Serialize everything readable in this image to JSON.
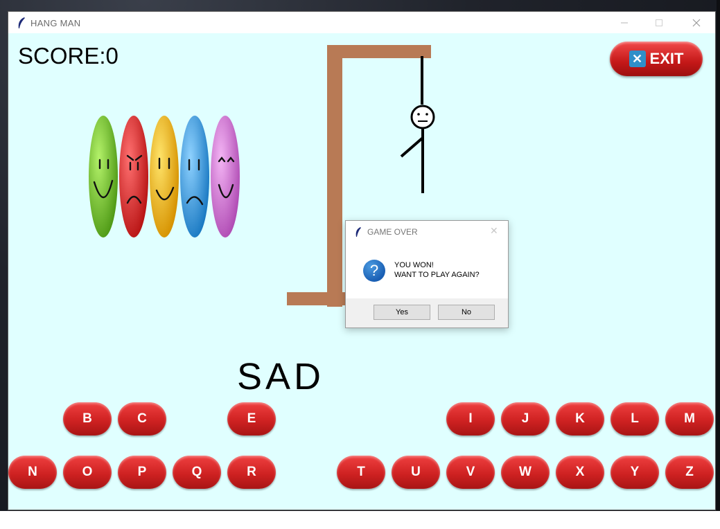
{
  "window": {
    "title": "HANG MAN",
    "icon": "feather-icon"
  },
  "score_label": "SCORE:0",
  "exit_button": {
    "label": "EXIT",
    "icon": "close-icon"
  },
  "word": "SAD",
  "letters_row1": [
    {
      "letter": "B",
      "slot": 1
    },
    {
      "letter": "C",
      "slot": 2
    },
    {
      "letter": "E",
      "slot": 4
    },
    {
      "letter": "I",
      "slot": 8
    },
    {
      "letter": "J",
      "slot": 9
    },
    {
      "letter": "K",
      "slot": 10
    },
    {
      "letter": "L",
      "slot": 11
    },
    {
      "letter": "M",
      "slot": 12
    }
  ],
  "letters_row2": [
    {
      "letter": "N",
      "slot": 0
    },
    {
      "letter": "O",
      "slot": 1
    },
    {
      "letter": "P",
      "slot": 2
    },
    {
      "letter": "Q",
      "slot": 3
    },
    {
      "letter": "R",
      "slot": 4
    },
    {
      "letter": "T",
      "slot": 6
    },
    {
      "letter": "U",
      "slot": 7
    },
    {
      "letter": "V",
      "slot": 8
    },
    {
      "letter": "W",
      "slot": 9
    },
    {
      "letter": "X",
      "slot": 10
    },
    {
      "letter": "Y",
      "slot": 11
    },
    {
      "letter": "Z",
      "slot": 12
    }
  ],
  "emoji_colors": [
    "#6cc22a",
    "#e02626",
    "#f5b60e",
    "#2f9de0",
    "#d46fd6"
  ],
  "colors": {
    "window_bg": "#e0ffff",
    "gallows": "#b87a55",
    "key_red": "#d42a2a"
  },
  "dialog": {
    "title": "GAME OVER",
    "icon": "question-icon",
    "message_line1": "YOU WON!",
    "message_line2": "WANT TO PLAY AGAIN?",
    "yes_label": "Yes",
    "no_label": "No"
  }
}
